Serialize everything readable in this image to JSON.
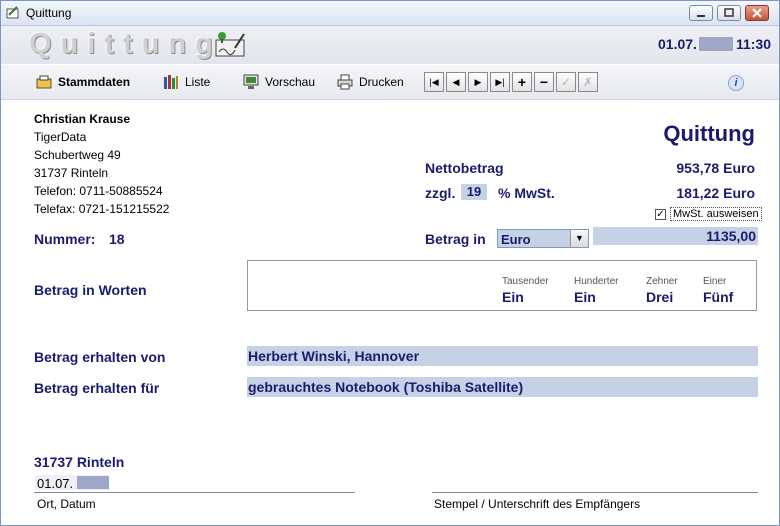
{
  "window": {
    "title": "Quittung"
  },
  "header": {
    "logo_text": "Quittung",
    "date": "01.07.",
    "time": "11:30"
  },
  "toolbar": {
    "stammdaten": "Stammdaten",
    "liste": "Liste",
    "vorschau": "Vorschau",
    "drucken": "Drucken",
    "nav": {
      "first": "|◀",
      "prev": "◀",
      "next": "▶",
      "last": "▶|",
      "add": "+",
      "remove": "−",
      "save": "✓",
      "cancel": "✗"
    },
    "info": "i"
  },
  "address": {
    "name": "Christian Krause",
    "company": "TigerData",
    "street": "Schubertweg 49",
    "city": "31737 Rinteln",
    "phone": "Telefon: 0711-50885524",
    "fax": "Telefax: 0721-151215522"
  },
  "receipt": {
    "title": "Quittung",
    "number_label": "Nummer:",
    "number": "18",
    "net_label": "Nettobetrag",
    "net_value": "953,78 Euro",
    "vat_prefix": "zzgl.",
    "vat_rate": "19",
    "vat_suffix": "% MwSt.",
    "vat_value": "181,22 Euro",
    "show_vat_label": "MwSt. ausweisen",
    "show_vat_checked": "✓",
    "amount_label": "Betrag in",
    "currency": "Euro",
    "amount": "1135,00",
    "words_label": "Betrag in Worten",
    "words": [
      {
        "unit": "Tausender",
        "word": "Ein"
      },
      {
        "unit": "Hunderter",
        "word": "Ein"
      },
      {
        "unit": "Zehner",
        "word": "Drei"
      },
      {
        "unit": "Einer",
        "word": "Fünf"
      }
    ],
    "from_label": "Betrag erhalten von",
    "from_value": "Herbert Winski, Hannover",
    "for_label": "Betrag erhalten für",
    "for_value": "gebrauchtes Notebook (Toshiba Satellite)"
  },
  "footer": {
    "place": "31737 Rinteln",
    "date": "01.07.",
    "place_date_label": "Ort, Datum",
    "signature_label": "Stempel / Unterschrift des Empfängers"
  },
  "colors": {
    "accent": "#1b1b6e",
    "field_bg": "#c6d1e6"
  }
}
